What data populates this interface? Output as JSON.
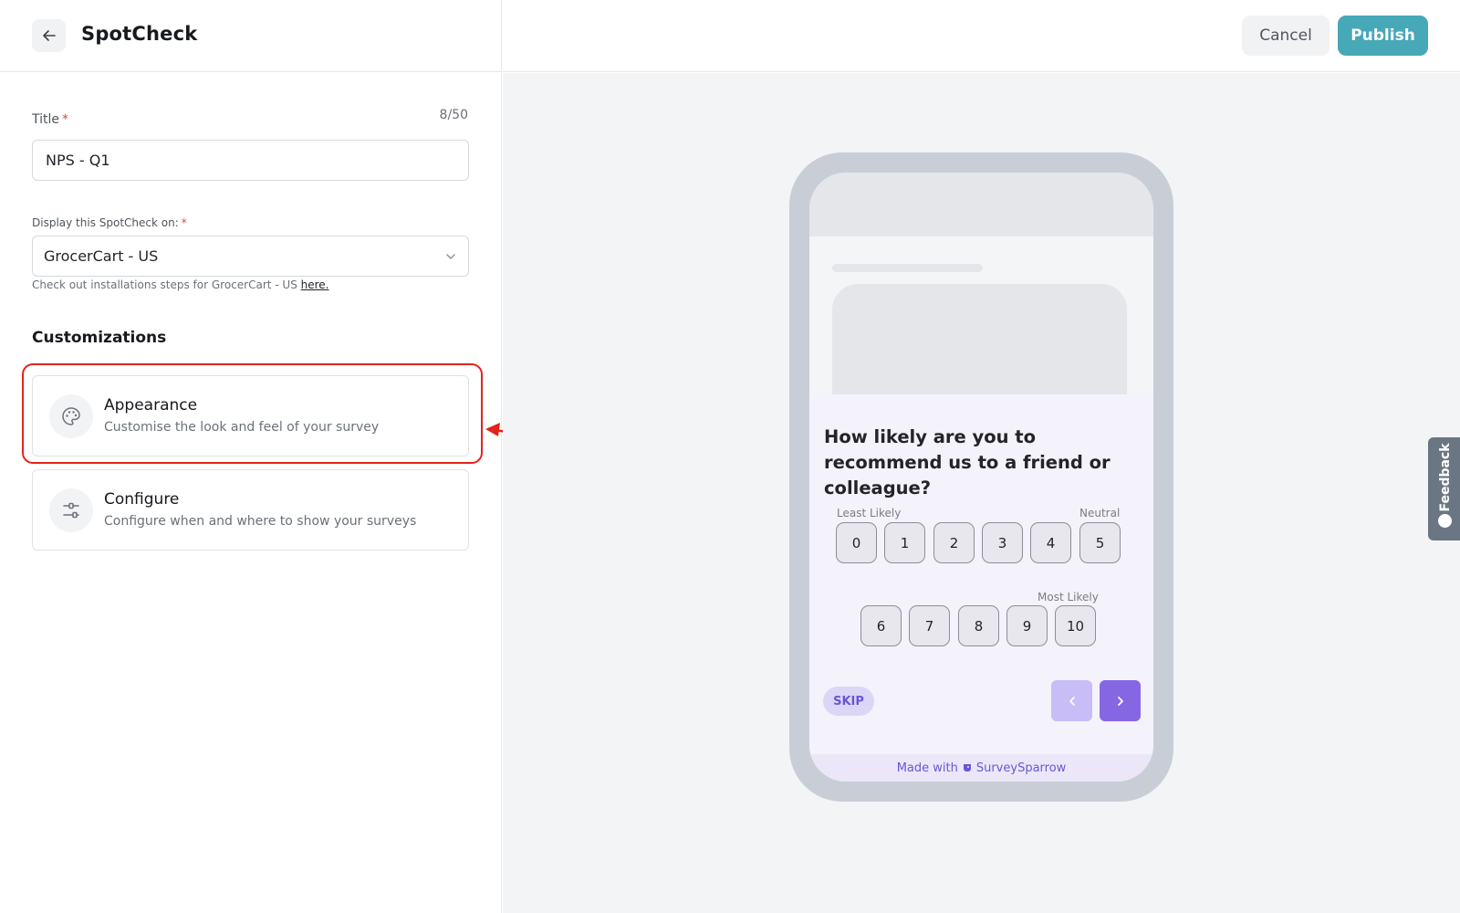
{
  "header": {
    "title": "SpotCheck",
    "cancel_label": "Cancel",
    "publish_label": "Publish"
  },
  "form": {
    "title_label": "Title",
    "title_counter": "8/50",
    "title_value": "NPS - Q1",
    "display_label": "Display this SpotCheck on:",
    "display_value": "GrocerCart - US",
    "help_text": "Check out installations steps for GrocerCart - US",
    "help_link": "here."
  },
  "customizations": {
    "heading": "Customizations",
    "cards": [
      {
        "title": "Appearance",
        "description": "Customise the look and feel of your survey",
        "icon": "palette-icon"
      },
      {
        "title": "Configure",
        "description": "Configure when and where to show your surveys",
        "icon": "sliders-icon"
      }
    ]
  },
  "preview": {
    "question": "How likely are you to recommend us to a friend or colleague?",
    "labels": {
      "least": "Least Likely",
      "neutral": "Neutral",
      "most": "Most Likely"
    },
    "scale_row1": [
      "0",
      "1",
      "2",
      "3",
      "4",
      "5"
    ],
    "scale_row2": [
      "6",
      "7",
      "8",
      "9",
      "10"
    ],
    "skip_label": "SKIP",
    "footer_prefix": "Made with",
    "footer_brand": "SurveySparrow"
  },
  "feedback_tab": {
    "label": "Feedback"
  },
  "colors": {
    "accent": "#47a8b8",
    "highlight": "#e3221b",
    "survey_primary": "#8567e4"
  }
}
